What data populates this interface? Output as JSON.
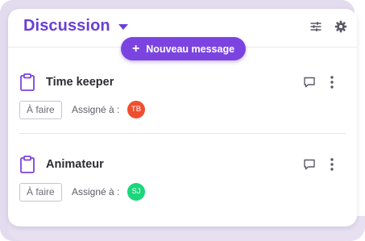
{
  "header": {
    "title": "Discussion",
    "title_icon": "chevron-down-icon",
    "actions": [
      "sliders-icon",
      "gear-icon"
    ]
  },
  "new_message_button": {
    "label": "Nouveau message",
    "icon": "plus-icon"
  },
  "tasks": [
    {
      "name": "Time keeper",
      "status": "À faire",
      "assigned_label": "Assigné à :",
      "assignee_initials": "TB",
      "assignee_color": "#ef4f2f"
    },
    {
      "name": "Animateur",
      "status": "À faire",
      "assigned_label": "Assigné à :",
      "assignee_initials": "SJ",
      "assignee_color": "#19d77a"
    }
  ],
  "colors": {
    "accent": "#6a3fd4",
    "button": "#7b44e0"
  }
}
